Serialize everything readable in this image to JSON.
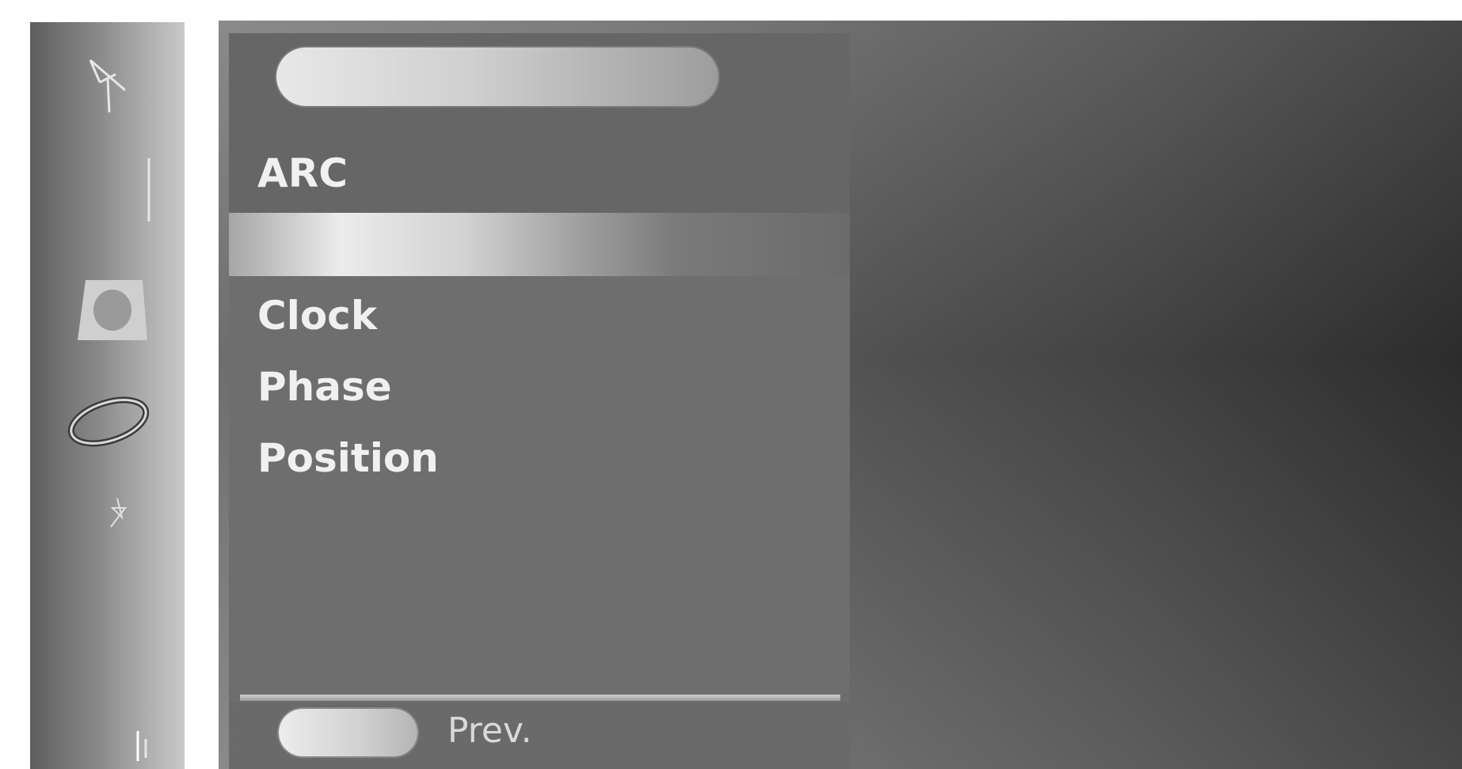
{
  "sidebar": {
    "icons": [
      "antenna-icon",
      "bar-icon",
      "bucket-icon",
      "ring-icon",
      "star-icon",
      "lines-icon"
    ]
  },
  "menu": {
    "title_value": "",
    "items": [
      {
        "label": "ARC"
      },
      {
        "label": ""
      },
      {
        "label": "Clock"
      },
      {
        "label": "Phase"
      },
      {
        "label": "Position"
      }
    ],
    "selected_index": 1
  },
  "footer": {
    "prev_label": "Prev."
  },
  "colors": {
    "panel": "#6b6b6b",
    "highlight": "#ececec",
    "text": "#f0f0f0"
  }
}
